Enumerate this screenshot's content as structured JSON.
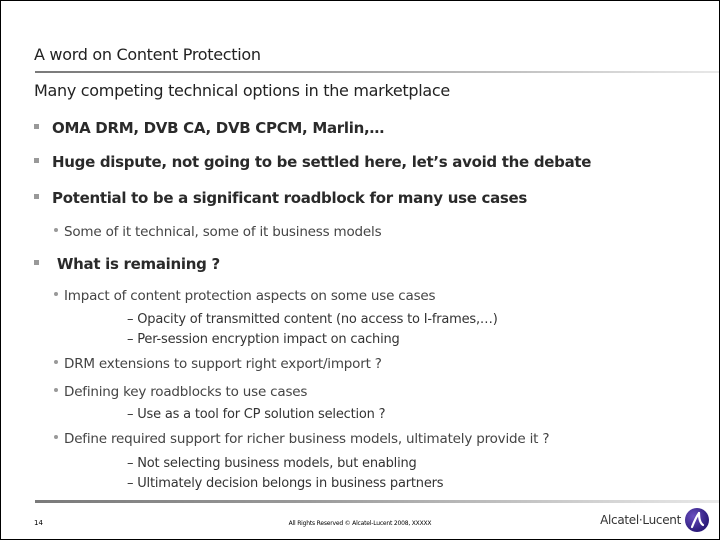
{
  "slide": {
    "title": "A word on Content Protection",
    "subtitle": "Many competing technical options in the marketplace",
    "bullets": [
      {
        "text": "OMA DRM, DVB CA, DVB CPCM, Marlin,…"
      },
      {
        "text": "Huge dispute, not going to be settled here, let’s avoid the debate"
      },
      {
        "text": "Potential to be a significant roadblock for many use cases",
        "children": [
          {
            "text": "Some of it technical, some of it business models"
          }
        ]
      },
      {
        "text": " What is remaining ?",
        "children": [
          {
            "text": "Impact of content protection aspects on some use cases",
            "children": [
              "– Opacity of transmitted content (no access to I-frames,…)",
              "– Per-session encryption impact on caching"
            ]
          },
          {
            "text": "DRM extensions to support right export/import ?"
          },
          {
            "text": "Defining key roadblocks to use cases",
            "children": [
              "– Use as a tool for CP solution selection ?"
            ]
          },
          {
            "text": "Define required support for richer business models, ultimately provide it ?",
            "children": [
              "– Not selecting business models, but enabling",
              "– Ultimately decision belongs in business partners"
            ]
          }
        ]
      }
    ]
  },
  "footer": {
    "page_number": "14",
    "copyright": "All Rights Reserved © Alcatel-Lucent 2008, XXXXX",
    "logo_text": "Alcatel·Lucent",
    "logo_icon": "alcatel-lucent-logo-icon",
    "logo_color": "#3a2590"
  }
}
